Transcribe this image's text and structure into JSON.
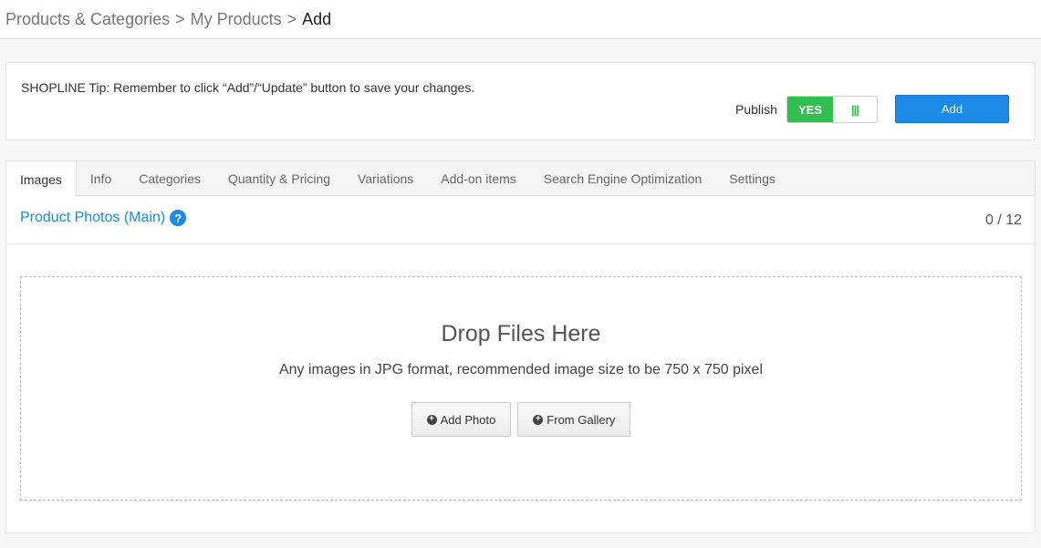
{
  "breadcrumb": {
    "items": [
      "Products & Categories",
      "My Products",
      "Add"
    ],
    "separator": ">"
  },
  "tip": {
    "text": "SHOPLINE Tip: Remember to click “Add”/“Update” button to save your changes."
  },
  "publish": {
    "label": "Publish",
    "toggle_on_label": "YES",
    "toggle_handle": "|||",
    "add_label": "Add"
  },
  "tabs": [
    {
      "label": "Images",
      "active": true
    },
    {
      "label": "Info"
    },
    {
      "label": "Categories"
    },
    {
      "label": "Quantity & Pricing"
    },
    {
      "label": "Variations"
    },
    {
      "label": "Add-on items"
    },
    {
      "label": "Search Engine Optimization"
    },
    {
      "label": "Settings"
    }
  ],
  "section": {
    "title": "Product Photos (Main)",
    "help_icon": "question-circle-icon",
    "count": "0 / 12"
  },
  "dropzone": {
    "title": "Drop Files Here",
    "description": "Any images in JPG format, recommended image size to be 750 x 750 pixel",
    "add_photo_label": "Add Photo",
    "from_gallery_label": "From Gallery"
  },
  "colors": {
    "accent": "#1a8ae6",
    "toggle_green": "#2fbf4f"
  }
}
